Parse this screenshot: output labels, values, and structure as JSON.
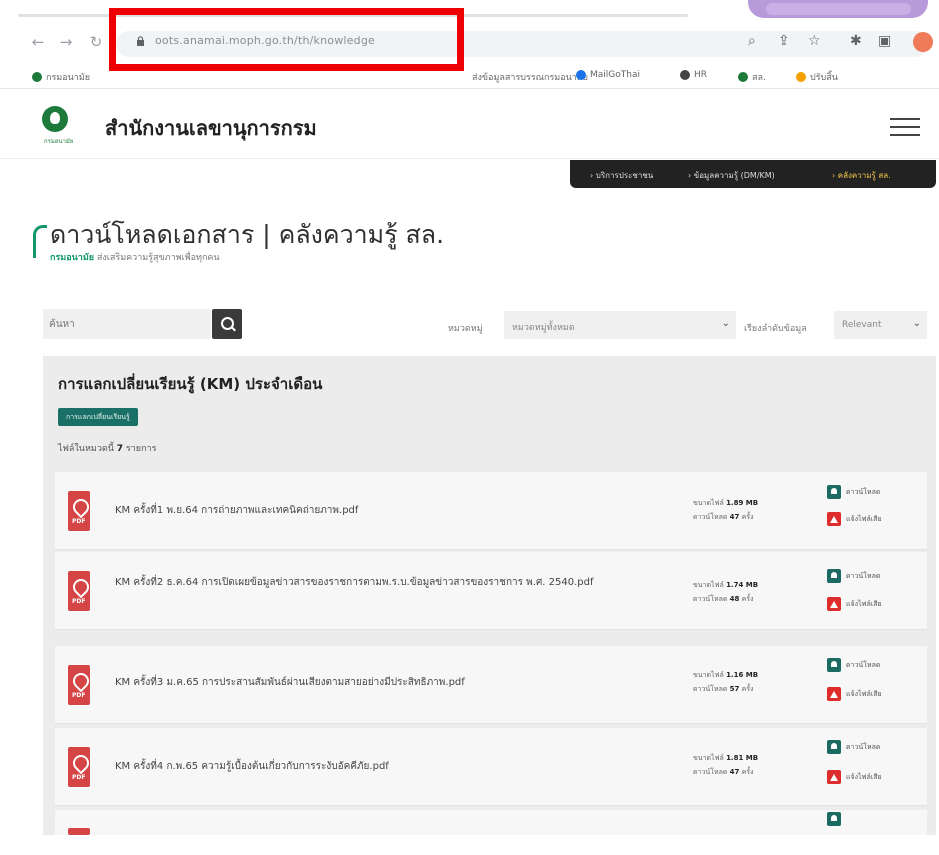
{
  "browser": {
    "url": "oots.anamai.moph.go.th/th/knowledge",
    "bookmarks": [
      {
        "label": "กรมอนามัย",
        "color": "#1d7a3a"
      },
      {
        "label": "ส่งข้อมูลสารบรรณกรมอนามัย",
        "color": "#aaaaaa"
      },
      {
        "label": "MailGoThai",
        "color": "#1a73e8"
      },
      {
        "label": "HR",
        "color": "#444444"
      },
      {
        "label": "สล.",
        "color": "#1d7a3a"
      },
      {
        "label": "ปรับสิ้น",
        "color": "#f4a000"
      }
    ]
  },
  "site": {
    "title": "สำนักงานเลขานุการกรม",
    "logo_sub": "กรมอนามัย"
  },
  "breadcrumb": [
    {
      "label": "บริการประชาชน"
    },
    {
      "label": "ข้อมูลความรู้ (DM/KM)"
    },
    {
      "label": "คลังความรู้ สล."
    }
  ],
  "page": {
    "title": "ดาวน์โหลดเอกสาร | คลังความรู้ สล.",
    "subtitle_brand": "กรมอนามัย",
    "subtitle_rest": "ส่งเสริมความรู้สุขภาพเพื่อทุกคน"
  },
  "filters": {
    "search_placeholder": "ค้นหา",
    "category_label": "หมวดหมู่",
    "category_value": "หมวดหมู่ทั้งหมด",
    "sort_label": "เรียงลำดับข้อมูล",
    "sort_value": "Relevant"
  },
  "category": {
    "title": "การแลกเปลี่ยนเรียนรู้ (KM) ประจำเดือน",
    "badge": "การแลกเปลี่ยนเรียนรู้",
    "count_prefix": "ไฟล์ในหมวดนี้",
    "count_value": "7",
    "count_suffix": "รายการ"
  },
  "labels": {
    "size": "ขนาดไฟล์",
    "downloads": "ดาวน์โหลด",
    "times": "ครั้ง",
    "download_action": "ดาวน์โหลด",
    "report_action": "แจ้งไฟล์เสีย"
  },
  "files": [
    {
      "name": "KM ครั้งที่1 พ.ย.64 การถ่ายภาพและเทคนิคถ่ายภาพ.pdf",
      "size": "1.89 MB",
      "downloads": "47"
    },
    {
      "name": "KM ครั้งที่2 ธ.ค.64 การเปิดเผยข้อมูลข่าวสารของราชการตามพ.ร.บ.ข้อมูลข่าวสารของราชการ พ.ศ. 2540.pdf",
      "size": "1.74 MB",
      "downloads": "48"
    },
    {
      "name": "KM ครั้งที่3 ม.ค.65 การประสานสัมพันธ์ผ่านเสียงตามสายอย่างมีประสิทธิภาพ.pdf",
      "size": "1.16 MB",
      "downloads": "57"
    },
    {
      "name": "KM ครั้งที่4 ก.พ.65 ความรู้เบื้องต้นเกี่ยวกับการระงับอัคคีภัย.pdf",
      "size": "1.81 MB",
      "downloads": "47"
    }
  ]
}
